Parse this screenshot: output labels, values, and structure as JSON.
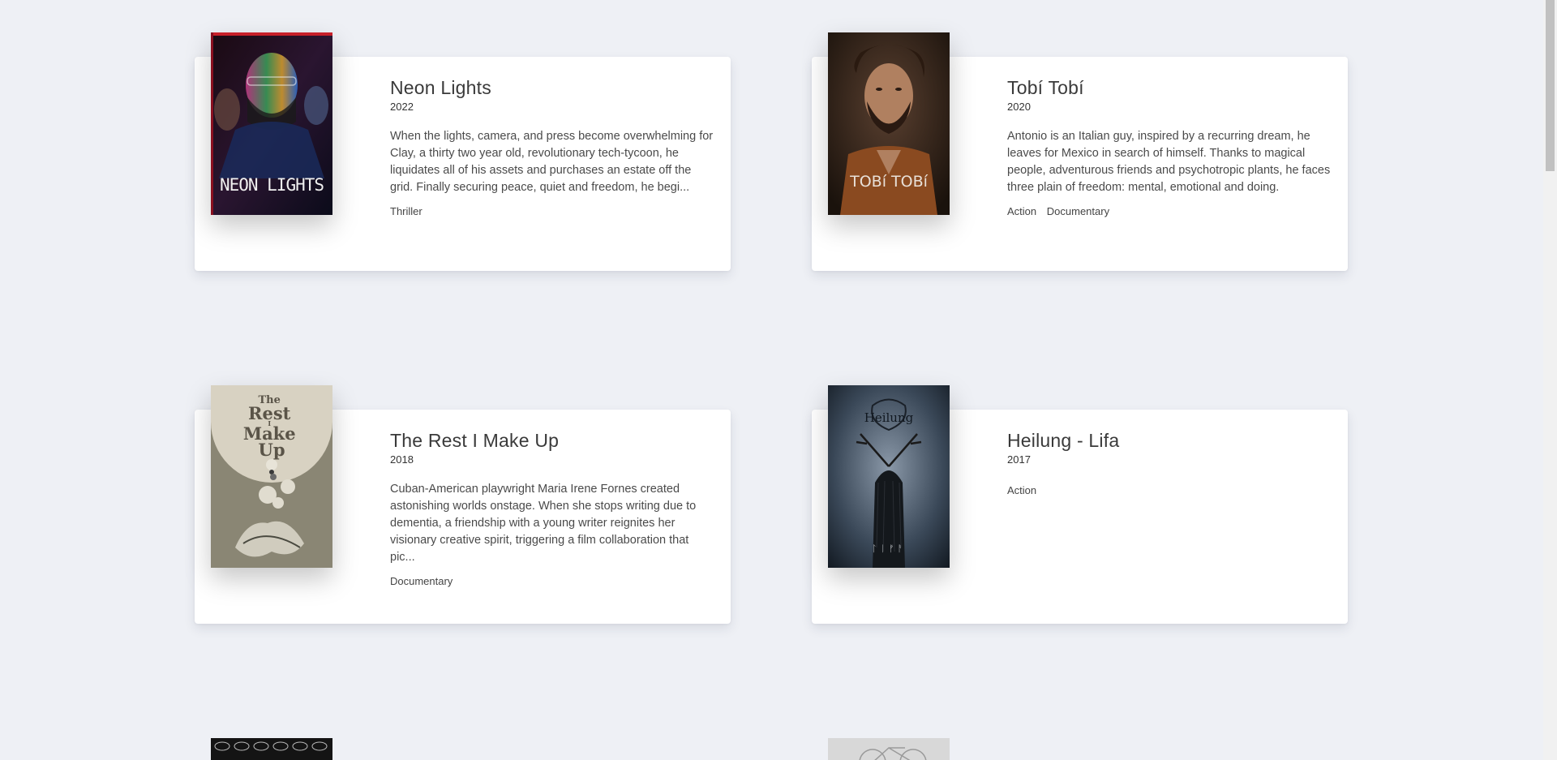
{
  "movies": [
    {
      "title": "Neon Lights",
      "year": "2022",
      "description": "When the lights, camera, and press become overwhelming for Clay, a thirty two year old, revolutionary tech-tycoon, he liquidates all of his assets and purchases an estate off the grid. Finally securing peace, quiet and freedom, he begi...",
      "genres": [
        "Thriller"
      ],
      "poster_text": "NEON LIGHTS"
    },
    {
      "title": "Tobí Tobí",
      "year": "2020",
      "description": "Antonio is an Italian guy, inspired by a recurring dream, he leaves for Mexico in search of himself. Thanks to magical people, adventurous friends and psychotropic plants, he faces three plain of freedom: mental, emotional and doing.",
      "genres": [
        "Action",
        "Documentary"
      ],
      "poster_text": "TOBí TOBí"
    },
    {
      "title": "The Rest I Make Up",
      "year": "2018",
      "description": "Cuban-American playwright Maria Irene Fornes created astonishing worlds onstage. When she stops writing due to dementia, a friendship with a young writer reignites her visionary creative spirit, triggering a film collaboration that pic...",
      "genres": [
        "Documentary"
      ],
      "poster_text": "The Rest I Make Up"
    },
    {
      "title": "Heilung - Lifa",
      "year": "2017",
      "description": "",
      "genres": [
        "Action"
      ],
      "poster_text": "Heilung"
    }
  ],
  "colors": {
    "background": "#eef0f5",
    "card": "#ffffff",
    "text": "#444444"
  }
}
